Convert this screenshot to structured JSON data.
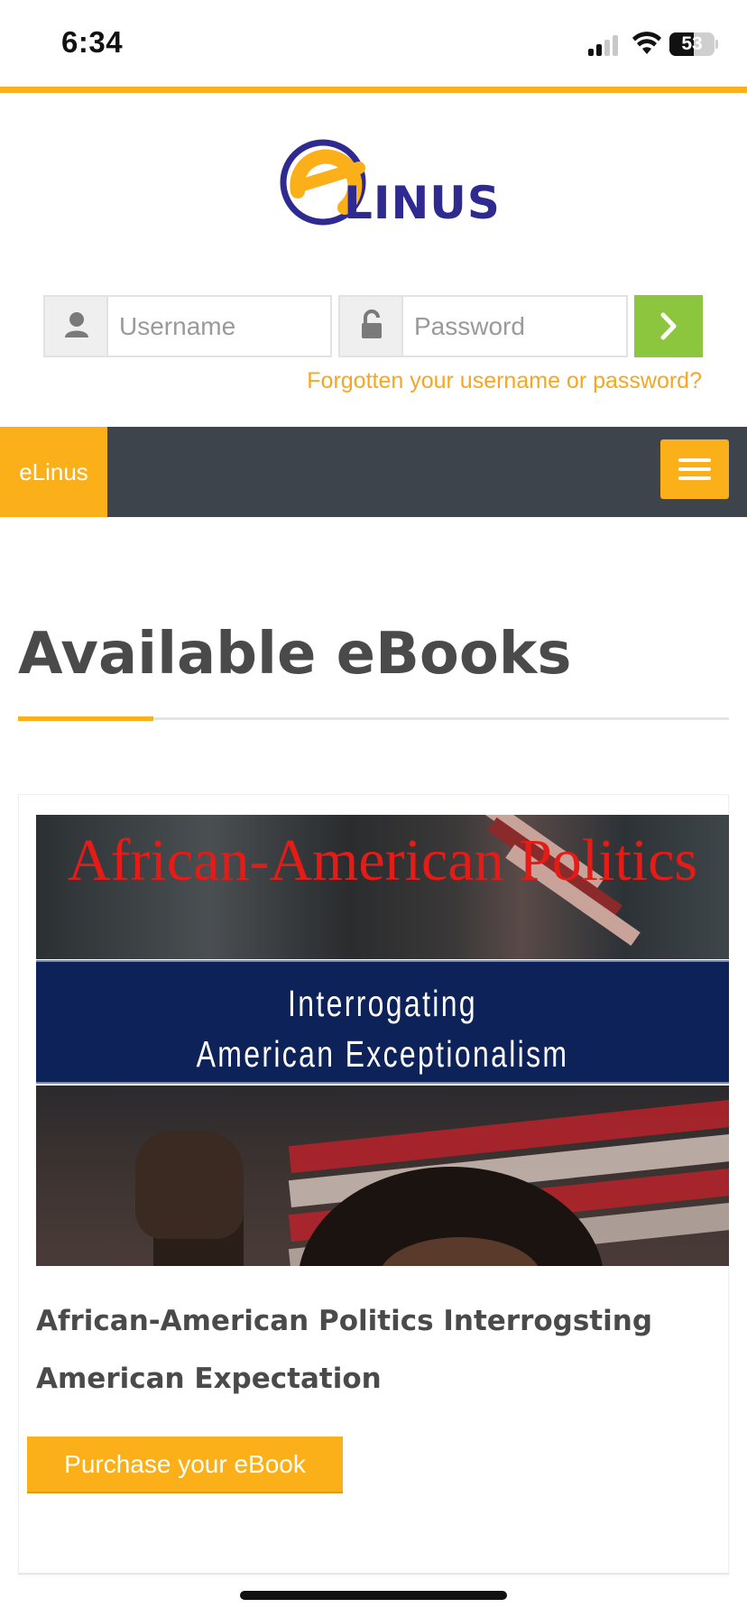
{
  "status_bar": {
    "time": "6:34",
    "battery": "53",
    "battery_level": 0.53
  },
  "brand": {
    "logo_text": "LINUS",
    "nav_label": "eLinus"
  },
  "login": {
    "username_placeholder": "Username",
    "password_placeholder": "Password",
    "forgot_link": "Forgotten your username or password?"
  },
  "colors": {
    "accent": "#fbaf18",
    "navbar": "#3d444c",
    "go_button": "#8cc63f",
    "link": "#f5a623",
    "logo_blue": "#2e2a8f"
  },
  "icons": {
    "user": "user-icon",
    "lock": "lock-icon",
    "go": "chevron-right-icon",
    "menu": "hamburger-icon"
  },
  "main": {
    "page_title": "Available eBooks",
    "books": [
      {
        "cover_title": "African-American Politics",
        "cover_subtitle_line1": "Interrogating",
        "cover_subtitle_line2": "American Exceptionalism",
        "title": "African-American Politics Interrogsting American Expectation",
        "button_label": "Purchase your eBook"
      }
    ]
  }
}
